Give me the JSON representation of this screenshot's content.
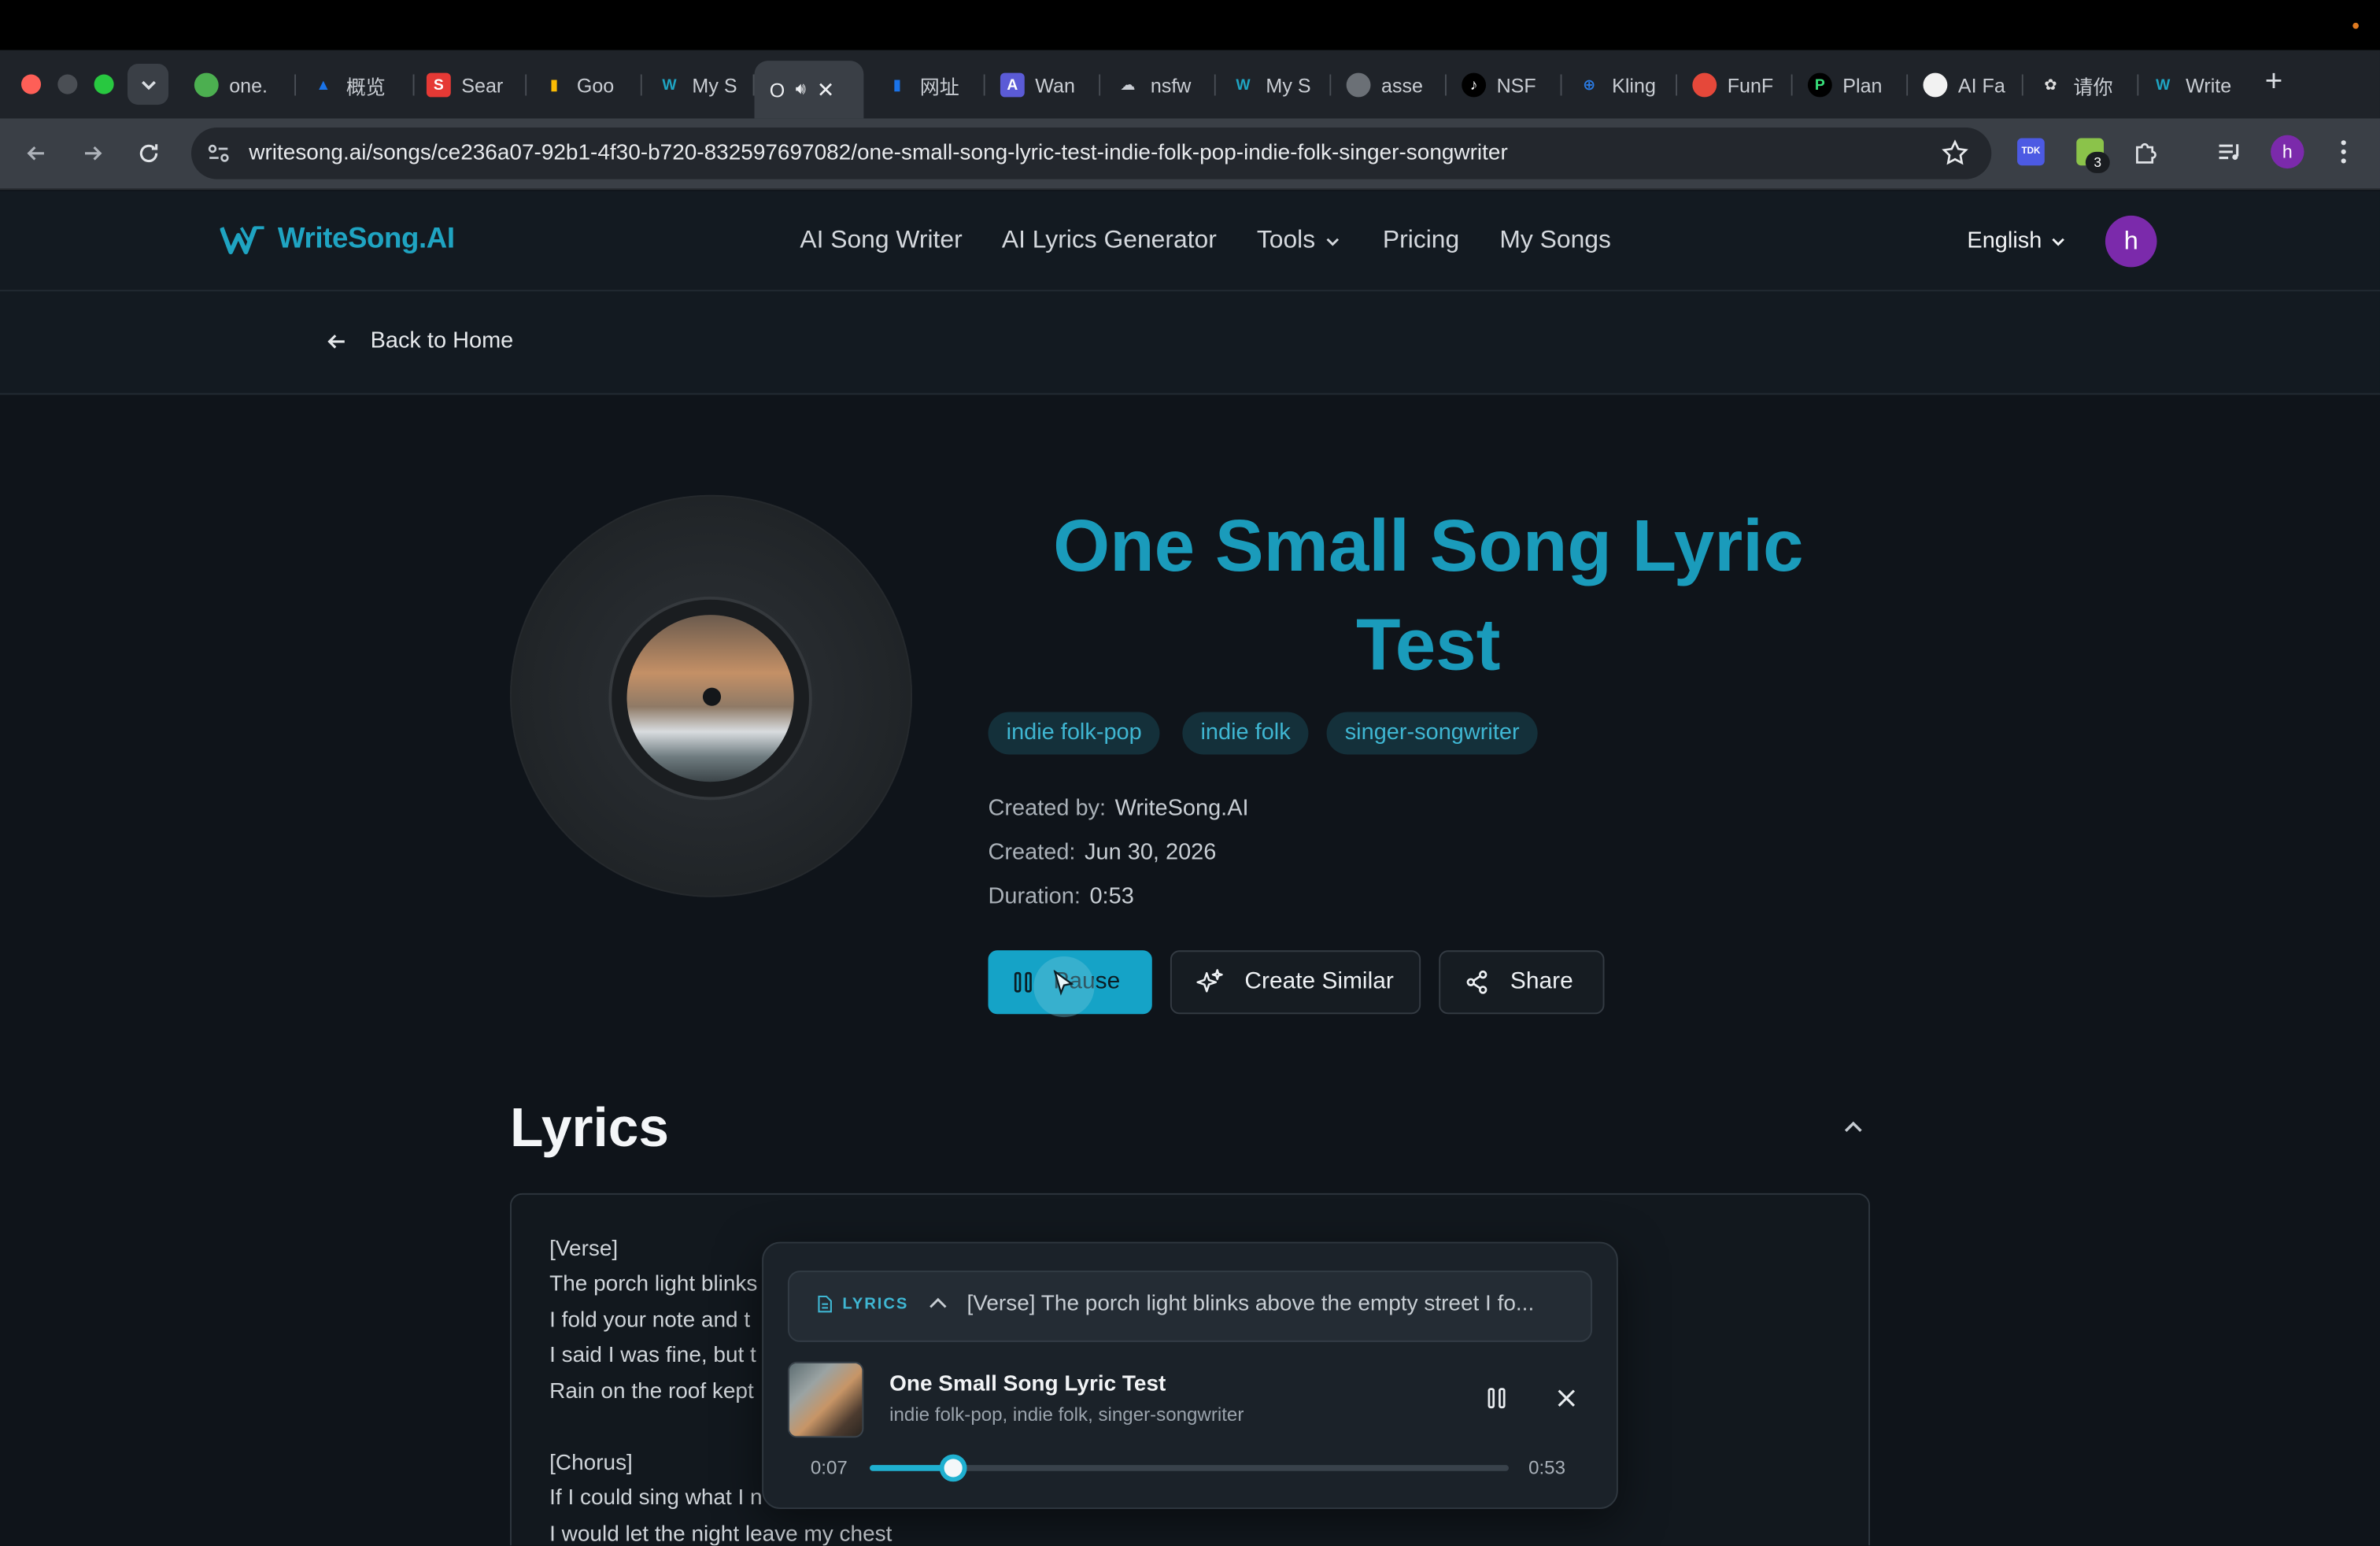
{
  "browser": {
    "tabs": [
      {
        "label": "one.",
        "color": "#4caf50"
      },
      {
        "label": "概览",
        "color": "#1a73e8"
      },
      {
        "label": "Sear",
        "color": "#e53935"
      },
      {
        "label": "Goo",
        "color": "#fbbc04"
      },
      {
        "label": "My S",
        "color": "#1fa4c2"
      },
      {
        "label": "O",
        "color": "#3a3f46"
      },
      {
        "label": "网址",
        "color": "#1a73e8"
      },
      {
        "label": "Wan",
        "color": "#5b5bd6"
      },
      {
        "label": "nsfw",
        "color": "#8b949c"
      },
      {
        "label": "My S",
        "color": "#1fa4c2"
      },
      {
        "label": "asse",
        "color": "#8b949c"
      },
      {
        "label": "NSF",
        "color": "#111111"
      },
      {
        "label": "Kling",
        "color": "#2a7be4"
      },
      {
        "label": "FunF",
        "color": "#e5483a"
      },
      {
        "label": "Plan",
        "color": "#111111"
      },
      {
        "label": "AI Fa",
        "color": "#f2f2f2"
      },
      {
        "label": "请你",
        "color": "#333333"
      },
      {
        "label": "Write",
        "color": "#1fa4c2"
      }
    ],
    "url": "writesong.ai/songs/ce236a07-92b1-4f30-b720-832597697082/one-small-song-lyric-test-indie-folk-pop-indie-folk-singer-songwriter",
    "ext_tdk": "TDK",
    "ext_badge": "3",
    "profile_initial": "h"
  },
  "header": {
    "logo_text": "WriteSong.AI",
    "nav": [
      "AI Song Writer",
      "AI Lyrics Generator",
      "Tools",
      "Pricing",
      "My Songs"
    ],
    "language": "English",
    "avatar_initial": "h"
  },
  "back_label": "Back to Home",
  "song": {
    "title_line1": "One Small Song Lyric",
    "title_line2": "Test",
    "tags": [
      "indie folk-pop",
      "indie folk",
      "singer-songwriter"
    ],
    "created_by_label": "Created by:",
    "created_by": "WriteSong.AI",
    "created_label": "Created:",
    "created": "Jun 30, 2026",
    "duration_label": "Duration:",
    "duration": "0:53",
    "pause_label": "Pause",
    "create_similar_label": "Create Similar",
    "share_label": "Share"
  },
  "lyrics": {
    "heading": "Lyrics",
    "lines": [
      "[Verse]",
      "The porch light blinks",
      "I fold your note and t",
      "I said I was fine, but t",
      "Rain on the roof kept",
      "",
      "[Chorus]",
      "If I could sing what I n",
      "I would let the night leave my chest"
    ]
  },
  "player": {
    "lyrics_label": "LYRICS",
    "preview": "[Verse] The porch light blinks above the empty street I fo...",
    "title": "One Small Song Lyric Test",
    "subtitle": "indie folk-pop, indie folk, singer-songwriter",
    "current_time": "0:07",
    "total_time": "0:53",
    "progress": 0.13
  }
}
